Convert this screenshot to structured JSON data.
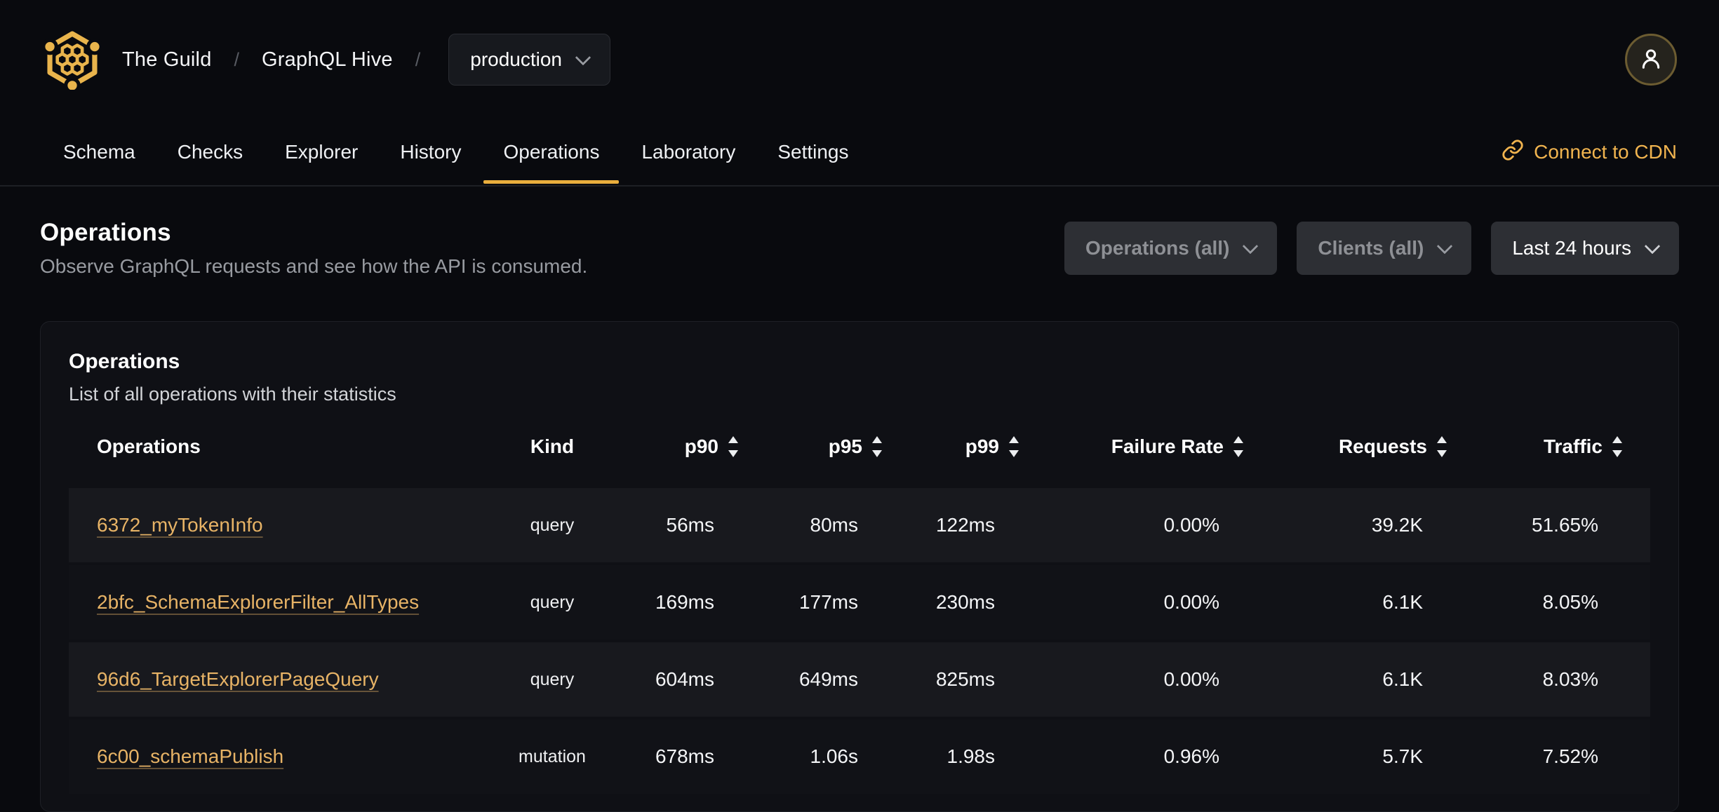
{
  "header": {
    "breadcrumb": {
      "org": "The Guild",
      "separator": "/",
      "project": "GraphQL Hive",
      "target": "production"
    }
  },
  "nav": {
    "tabs": [
      {
        "label": "Schema"
      },
      {
        "label": "Checks"
      },
      {
        "label": "Explorer"
      },
      {
        "label": "History"
      },
      {
        "label": "Operations",
        "active": true
      },
      {
        "label": "Laboratory"
      },
      {
        "label": "Settings"
      }
    ],
    "cdn_link_label": "Connect to CDN"
  },
  "page": {
    "title": "Operations",
    "subtitle": "Observe GraphQL requests and see how the API is consumed."
  },
  "filters": {
    "operations_label": "Operations (all)",
    "clients_label": "Clients (all)",
    "period_label": "Last 24 hours"
  },
  "card": {
    "title": "Operations",
    "subtitle": "List of all operations with their statistics"
  },
  "table": {
    "columns": {
      "operations": "Operations",
      "kind": "Kind",
      "p90": "p90",
      "p95": "p95",
      "p99": "p99",
      "failure_rate": "Failure Rate",
      "requests": "Requests",
      "traffic": "Traffic"
    },
    "rows": [
      {
        "name": "6372_myTokenInfo",
        "kind": "query",
        "p90": "56ms",
        "p95": "80ms",
        "p99": "122ms",
        "failure_rate": "0.00%",
        "requests": "39.2K",
        "traffic": "51.65%"
      },
      {
        "name": "2bfc_SchemaExplorerFilter_AllTypes",
        "kind": "query",
        "p90": "169ms",
        "p95": "177ms",
        "p99": "230ms",
        "failure_rate": "0.00%",
        "requests": "6.1K",
        "traffic": "8.05%"
      },
      {
        "name": "96d6_TargetExplorerPageQuery",
        "kind": "query",
        "p90": "604ms",
        "p95": "649ms",
        "p99": "825ms",
        "failure_rate": "0.00%",
        "requests": "6.1K",
        "traffic": "8.03%"
      },
      {
        "name": "6c00_schemaPublish",
        "kind": "mutation",
        "p90": "678ms",
        "p95": "1.06s",
        "p99": "1.98s",
        "failure_rate": "0.96%",
        "requests": "5.7K",
        "traffic": "7.52%"
      }
    ]
  },
  "colors": {
    "accent_gold": "#e9ae3d",
    "link_gold": "#e7b366",
    "background": "#090a0e"
  }
}
